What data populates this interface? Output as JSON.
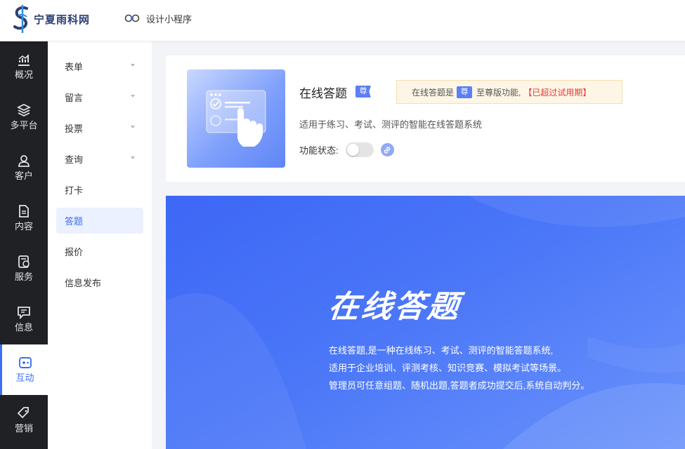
{
  "brand": {
    "name": "宁夏雨科网",
    "logo_icon": "brand-s-logo"
  },
  "topbar": {
    "design_label": "设计小程序",
    "design_icon": "mini-program-icon"
  },
  "leftnav": {
    "items": [
      {
        "label": "概况",
        "icon": "chart-icon",
        "active": false
      },
      {
        "label": "多平台",
        "icon": "layers-icon",
        "active": false
      },
      {
        "label": "客户",
        "icon": "user-icon",
        "active": false
      },
      {
        "label": "内容",
        "icon": "document-icon",
        "active": false
      },
      {
        "label": "服务",
        "icon": "service-icon",
        "active": false
      },
      {
        "label": "信息",
        "icon": "message-icon",
        "active": false
      },
      {
        "label": "互动",
        "icon": "gamepad-icon",
        "active": true
      },
      {
        "label": "营销",
        "icon": "tag-icon",
        "active": false
      }
    ]
  },
  "submenu": {
    "items": [
      {
        "label": "表单",
        "expandable": true
      },
      {
        "label": "留言",
        "expandable": true
      },
      {
        "label": "投票",
        "expandable": true
      },
      {
        "label": "查询",
        "expandable": true
      },
      {
        "label": "打卡",
        "expandable": false
      },
      {
        "label": "答题",
        "expandable": false,
        "active": true
      },
      {
        "label": "报价",
        "expandable": false
      },
      {
        "label": "信息发布",
        "expandable": false
      }
    ]
  },
  "feature": {
    "title": "在线答题",
    "badge": "尊",
    "notice_prefix": "在线答题是",
    "notice_badge": "尊",
    "notice_suffix": "至尊版功能,",
    "notice_warn": "【已超过试用期】",
    "description": "适用于练习、考试、测评的智能在线答题系统",
    "status_label": "功能状态:",
    "status_on": false
  },
  "banner": {
    "title": "在线答题",
    "lines": [
      "在线答题,是一种在线练习、考试、测评的智能答题系统,",
      "适用于企业培训、评测考核、知识竞赛、模拟考试等场景。",
      "管理员可任意组题、随机出题,答题者成功提交后,系统自动判分。"
    ]
  },
  "colors": {
    "accent": "#3b6ff6",
    "nav_bg": "#1f2125",
    "warn": "#e33b3b",
    "banner": "#4a76f8"
  }
}
